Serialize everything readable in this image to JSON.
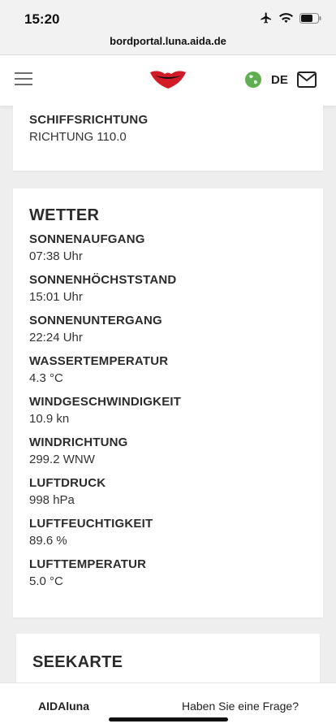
{
  "status_bar": {
    "time": "15:20",
    "url": "bordportal.luna.aida.de"
  },
  "header": {
    "language": "DE"
  },
  "ship_direction": {
    "label": "SCHIFFSRICHTUNG",
    "value": "RICHTUNG 110.0"
  },
  "weather": {
    "title": "WETTER",
    "items": [
      {
        "label": "SONNENAUFGANG",
        "value": "07:38 Uhr"
      },
      {
        "label": "SONNENHÖCHSTSTAND",
        "value": "15:01 Uhr"
      },
      {
        "label": "SONNENUNTERGANG",
        "value": "22:24 Uhr"
      },
      {
        "label": "WASSERTEMPERATUR",
        "value": "4.3 °C"
      },
      {
        "label": "WINDGESCHWINDIGKEIT",
        "value": "10.9 kn"
      },
      {
        "label": "WINDRICHTUNG",
        "value": "299.2 WNW"
      },
      {
        "label": "LUFTDRUCK",
        "value": "998 hPa"
      },
      {
        "label": "LUFTFEUCHTIGKEIT",
        "value": "89.6 %"
      },
      {
        "label": "LUFTTEMPERATUR",
        "value": "5.0 °C"
      }
    ]
  },
  "sea_chart": {
    "title": "SEEKARTE"
  },
  "bottom_bar": {
    "brand": "AIDAluna",
    "question_link": "Haben Sie eine Frage?"
  },
  "icons": {
    "menu": "hamburger-icon",
    "logo": "aida-lips-logo",
    "globe": "globe-icon",
    "mail": "mail-icon",
    "airplane": "airplane-icon",
    "wifi": "wifi-icon",
    "battery": "battery-icon"
  },
  "colors": {
    "brand_red": "#d21b26",
    "globe_green": "#5fae4f"
  }
}
